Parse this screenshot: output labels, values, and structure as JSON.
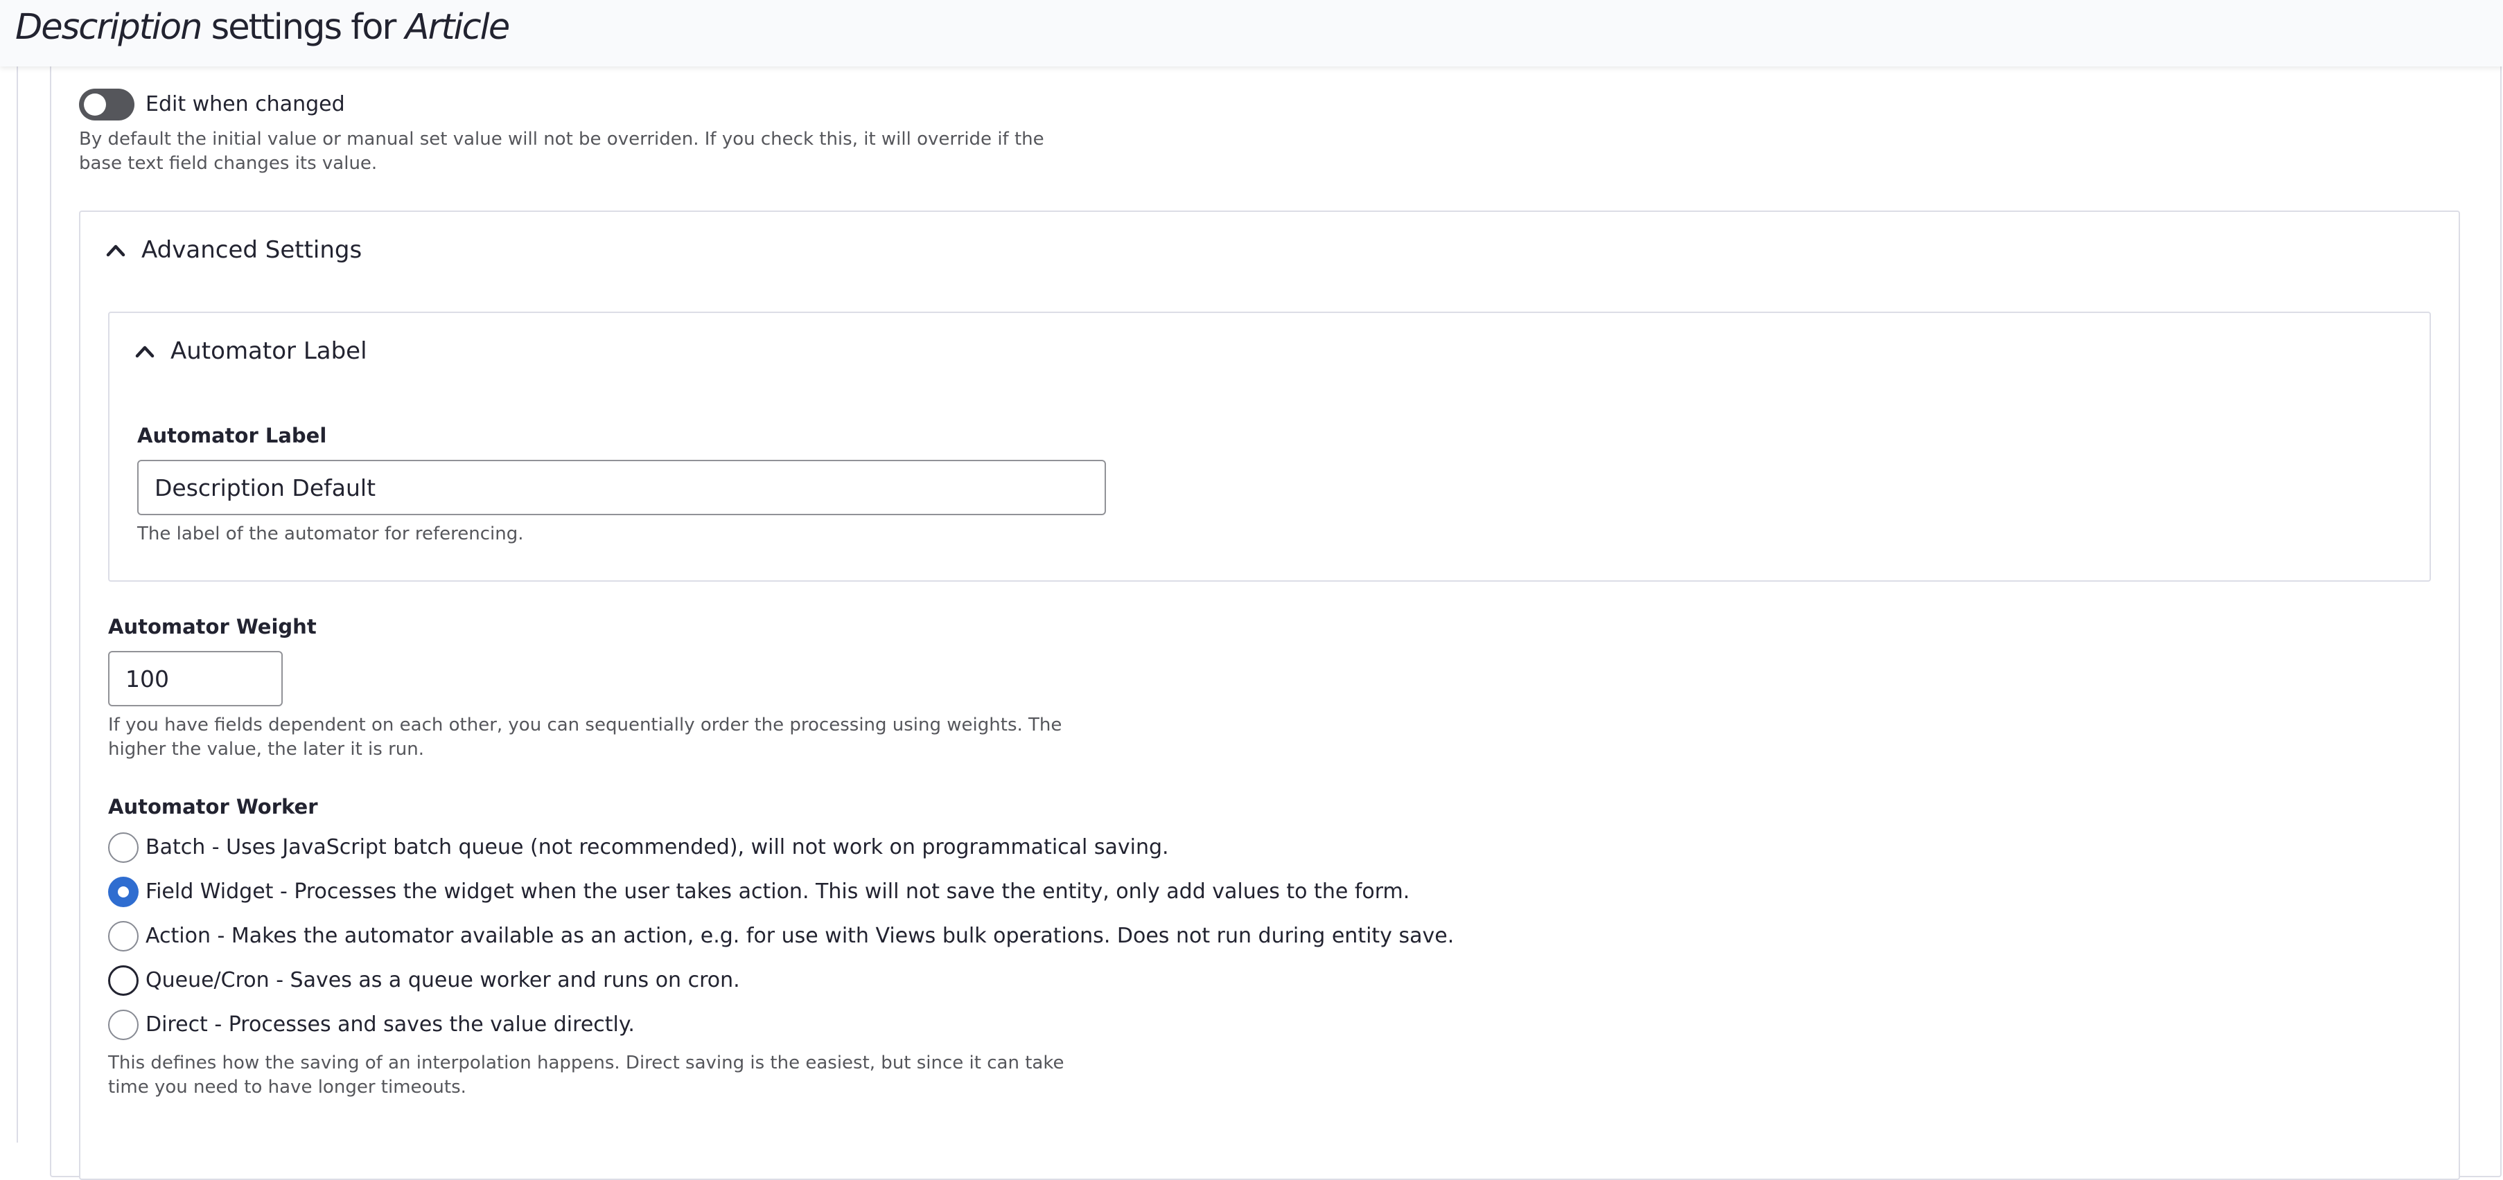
{
  "header": {
    "title_field": "Description",
    "title_middle": " settings for ",
    "title_entity": "Article"
  },
  "edit_when_changed": {
    "label": "Edit when changed",
    "checked": false,
    "description_line1": "By default the initial value or manual set value will not be overriden. If you check this, it will override if the",
    "description_line2": "base text field changes its value."
  },
  "advanced_settings": {
    "summary": "Advanced Settings",
    "expanded": true,
    "automator_label_section": {
      "summary": "Automator Label",
      "expanded": true,
      "field_label": "Automator Label",
      "value": "Description Default",
      "description": "The label of the automator for referencing."
    },
    "automator_weight": {
      "label": "Automator Weight",
      "value": "100",
      "description_line1": "If you have fields dependent on each other, you can sequentially order the processing using weights. The",
      "description_line2": "higher the value, the later it is run."
    },
    "automator_worker": {
      "label": "Automator Worker",
      "selected": "Field Widget",
      "options": [
        {
          "label": "Batch - Uses JavaScript batch queue (not recommended), will not work on programmatical saving."
        },
        {
          "label": "Field Widget - Processes the widget when the user takes action. This will not save the entity, only add values to the form."
        },
        {
          "label": "Action - Makes the automator available as an action, e.g. for use with Views bulk operations. Does not run during entity save."
        },
        {
          "label": "Queue/Cron - Saves as a queue worker and runs on cron."
        },
        {
          "label": "Direct - Processes and saves the value directly."
        }
      ],
      "description_line1": "This defines how the saving of an interpolation happens. Direct saving is the easiest, but since it can take",
      "description_line2": "time you need to have longer timeouts."
    }
  },
  "colors": {
    "accent": "#2f6dd0",
    "text": "#222330",
    "muted_text": "#55565b",
    "border": "#dcdde6",
    "input_border": "#919297",
    "toggle_off": "#55565b",
    "header_bg": "#f9fafc"
  },
  "icons": {
    "summary_toggle": "chevron-up-icon"
  }
}
